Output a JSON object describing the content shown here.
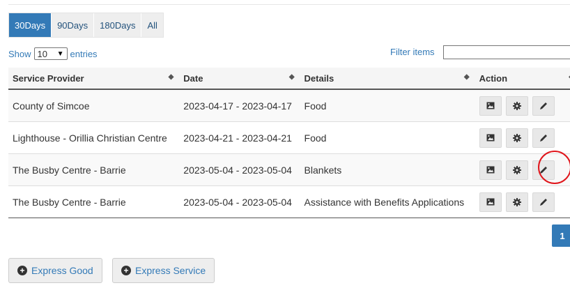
{
  "range_tabs": [
    "30Days",
    "90Days",
    "180Days",
    "All"
  ],
  "active_range": "30Days",
  "length_menu": {
    "prefix": "Show",
    "value": "10",
    "suffix": "entries"
  },
  "filter": {
    "label": "Filter items",
    "value": ""
  },
  "columns": [
    "Service Provider",
    "Date",
    "Details",
    "Action"
  ],
  "rows": [
    {
      "provider": "County of Simcoe",
      "date": "2023-04-17 - 2023-04-17",
      "details": "Food"
    },
    {
      "provider": "Lighthouse - Orillia Christian Centre",
      "date": "2023-04-21 - 2023-04-21",
      "details": "Food"
    },
    {
      "provider": "The Busby Centre - Barrie",
      "date": "2023-05-04 - 2023-05-04",
      "details": "Blankets"
    },
    {
      "provider": "The Busby Centre - Barrie",
      "date": "2023-05-04 - 2023-05-04",
      "details": "Assistance with Benefits Applications"
    }
  ],
  "action_icons": [
    "image-icon",
    "gear-icon",
    "pencil-icon"
  ],
  "pagination": {
    "current_page": "1"
  },
  "buttons": {
    "express_good": "Express Good",
    "express_service": "Express Service"
  },
  "colors": {
    "primary": "#337ab7",
    "highlight": "#e0151b"
  }
}
